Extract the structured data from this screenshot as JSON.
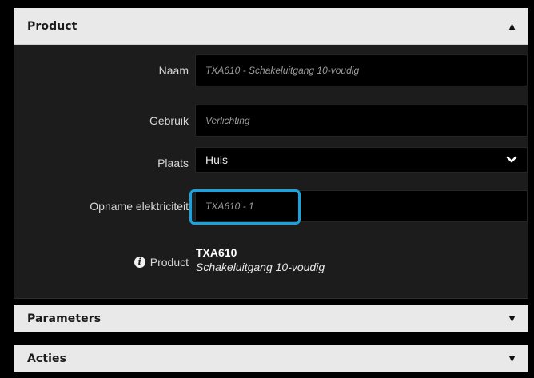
{
  "product": {
    "title": "Product",
    "state_icon": "triangle-up-icon",
    "fields": {
      "naam": {
        "label": "Naam",
        "value": "TXA610 - Schakeluitgang 10-voudig"
      },
      "gebruik": {
        "label": "Gebruik",
        "value": "Verlichting"
      },
      "plaats": {
        "label": "Plaats",
        "value": "Huis"
      },
      "opname": {
        "label": "Opname elektriciteit",
        "value": "TXA610 - 1"
      }
    },
    "info": {
      "label": "Product",
      "code": "TXA610",
      "description": "Schakeluitgang 10-voudig"
    }
  },
  "parameters": {
    "title": "Parameters",
    "state_icon": "triangle-down-icon"
  },
  "acties": {
    "title": "Acties",
    "state_icon": "triangle-down-icon"
  },
  "colors": {
    "focus": "#16a3e0",
    "header_bg": "#e9e9e9",
    "panel_bg": "#1c1c1c",
    "field_bg": "#000000"
  }
}
